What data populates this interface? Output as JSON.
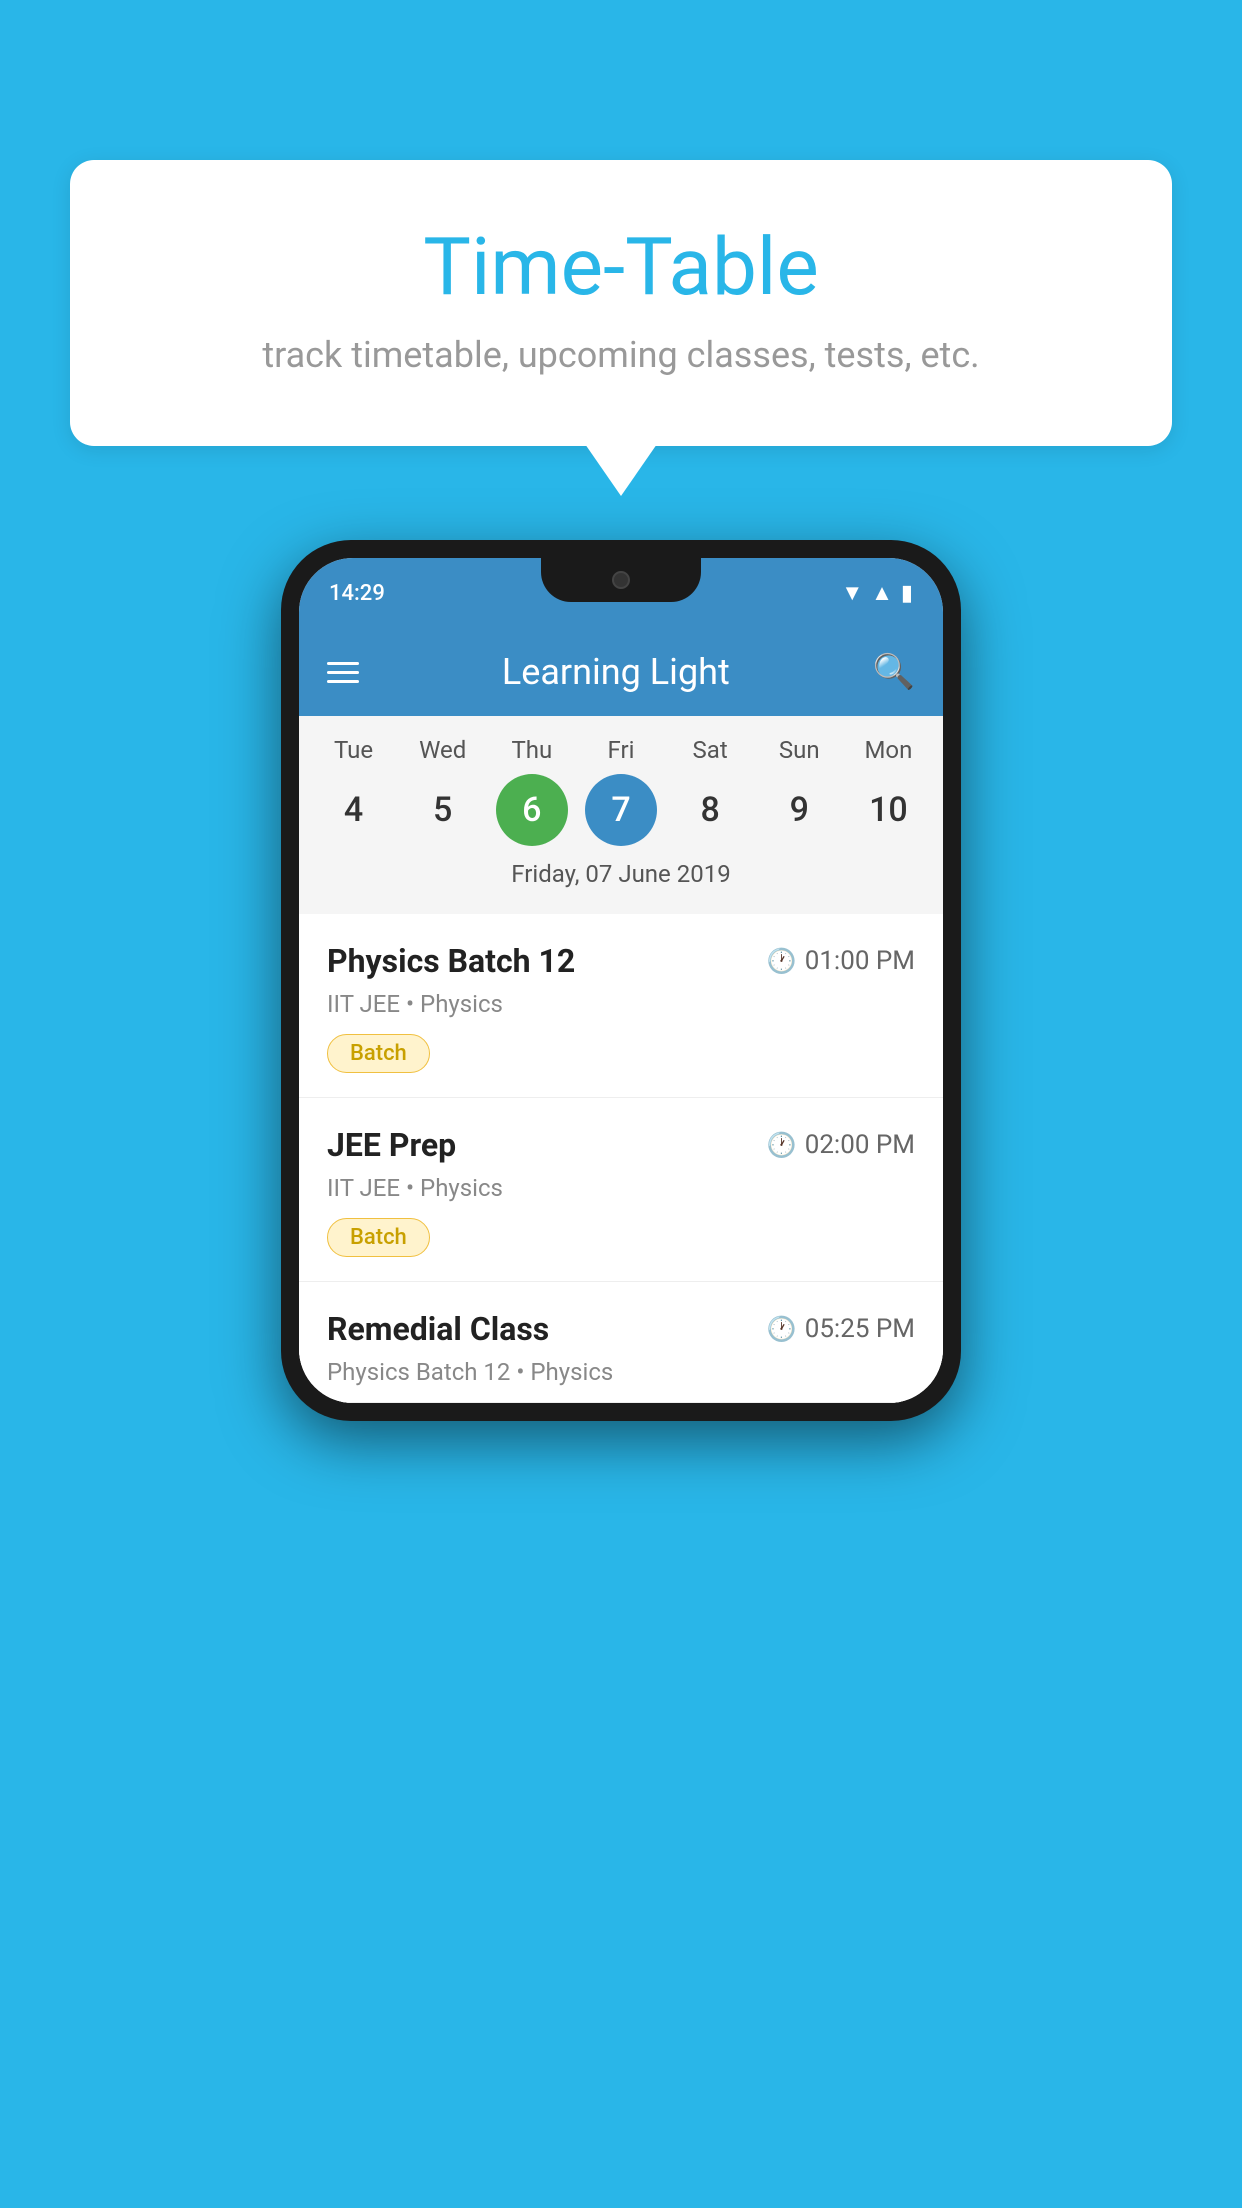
{
  "page": {
    "background_color": "#29b6e8"
  },
  "bubble": {
    "title": "Time-Table",
    "subtitle": "track timetable, upcoming classes, tests, etc."
  },
  "phone": {
    "status_bar": {
      "time": "14:29"
    },
    "app_header": {
      "title": "Learning Light"
    },
    "calendar": {
      "days": [
        {
          "label": "Tue",
          "number": "4"
        },
        {
          "label": "Wed",
          "number": "5"
        },
        {
          "label": "Thu",
          "number": "6",
          "state": "today"
        },
        {
          "label": "Fri",
          "number": "7",
          "state": "selected"
        },
        {
          "label": "Sat",
          "number": "8"
        },
        {
          "label": "Sun",
          "number": "9"
        },
        {
          "label": "Mon",
          "number": "10"
        }
      ],
      "selected_date_label": "Friday, 07 June 2019"
    },
    "schedule": [
      {
        "title": "Physics Batch 12",
        "time": "01:00 PM",
        "subtitle": "IIT JEE • Physics",
        "badge": "Batch"
      },
      {
        "title": "JEE Prep",
        "time": "02:00 PM",
        "subtitle": "IIT JEE • Physics",
        "badge": "Batch"
      },
      {
        "title": "Remedial Class",
        "time": "05:25 PM",
        "subtitle": "Physics Batch 12 • Physics",
        "badge": null,
        "partial": true
      }
    ]
  }
}
